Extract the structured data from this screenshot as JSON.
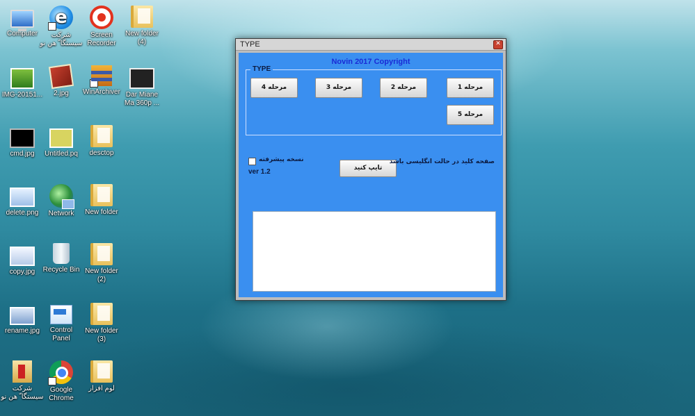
{
  "desktop": {
    "icons": [
      {
        "label": "Computer",
        "icon": "computer-icon"
      },
      {
        "label": "شرکت\nسیستگا ّ هن نو",
        "icon": "internet-explorer-icon"
      },
      {
        "label": "Screen\nRecorder",
        "icon": "screen-recorder-icon"
      },
      {
        "label": "New folder\n(4)",
        "icon": "folder-icon"
      },
      {
        "label": "IMG-20151...",
        "icon": "photo-icon"
      },
      {
        "label": "2.jpg",
        "icon": "image-file-icon"
      },
      {
        "label": "WinArchiver",
        "icon": "winarchiver-icon"
      },
      {
        "label": "Dar Miane\nMa 360p ...",
        "icon": "video-file-icon"
      },
      {
        "label": "cmd.jpg",
        "icon": "image-file-icon"
      },
      {
        "label": "Untitled.pq",
        "icon": "image-file-icon"
      },
      {
        "label": "desctop",
        "icon": "folder-icon"
      },
      {
        "label": "delete.png",
        "icon": "image-file-icon"
      },
      {
        "label": "Network",
        "icon": "network-icon"
      },
      {
        "label": "New folder",
        "icon": "folder-icon"
      },
      {
        "label": "copy.jpg",
        "icon": "image-file-icon"
      },
      {
        "label": "Recycle Bin",
        "icon": "recycle-bin-icon"
      },
      {
        "label": "New folder\n(2)",
        "icon": "folder-icon"
      },
      {
        "label": "rename.jpg",
        "icon": "image-file-icon"
      },
      {
        "label": "Control\nPanel",
        "icon": "control-panel-icon"
      },
      {
        "label": "New folder\n(3)",
        "icon": "folder-icon"
      },
      {
        "label": "شرکت\nسیستگا ّ هن نو",
        "icon": "folder-shortcut-icon"
      },
      {
        "label": "Google\nChrome",
        "icon": "chrome-icon"
      },
      {
        "label": "لوم افزار",
        "icon": "folder-icon"
      }
    ]
  },
  "window": {
    "title": "TYPE",
    "copyright": "Novin 2017 Copyright",
    "group_label": "TYPE",
    "stages": [
      "مرحله 1",
      "مرحله 2",
      "مرحله 3",
      "مرحله 4",
      "مرحله 5"
    ],
    "advanced_checkbox": {
      "label": "نسخه پیشرفته",
      "checked": false
    },
    "version": "ver 1.2",
    "note": "صفحه کلید در حالت انگلیسی باشد",
    "confirm_button": "تایپ کنید",
    "output_text": ""
  },
  "colors": {
    "client_bg": "#3a8ff0",
    "copyright_text": "#1a2bd6"
  }
}
